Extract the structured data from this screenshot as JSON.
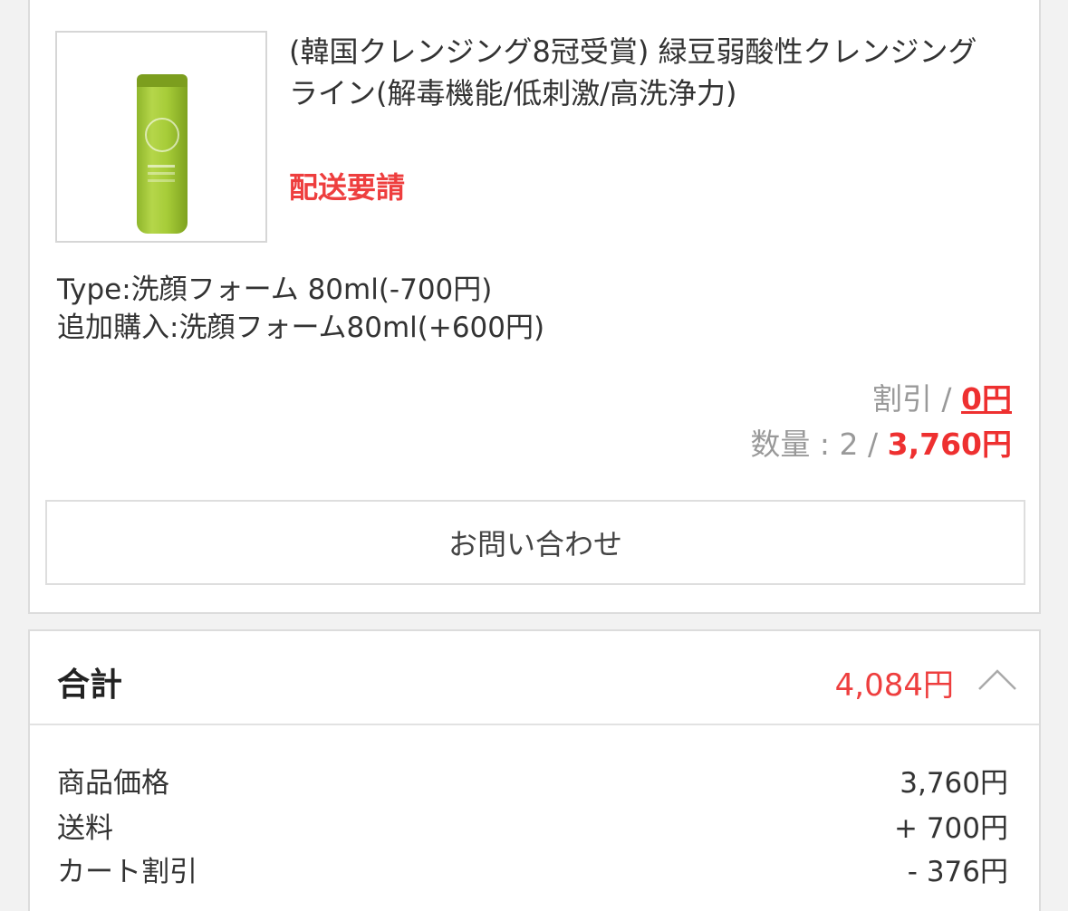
{
  "product": {
    "title": "(韓国クレンジング8冠受賞) 緑豆弱酸性クレンジング ライン(解毒機能/低刺激/高洗浄力)",
    "status": "配送要請",
    "options": [
      "Type:洗顔フォーム 80ml(-700円)",
      "追加購入:洗顔フォーム80ml(+600円)"
    ],
    "discount_label": "割引 / ",
    "discount_value": "0円",
    "quantity_label": "数量 : 2 / ",
    "quantity_total": "3,760円",
    "inquiry_button": "お問い合わせ"
  },
  "summary": {
    "title": "合計",
    "total": "4,084円",
    "rows": [
      {
        "label": "商品価格",
        "value": "3,760円"
      },
      {
        "label": "送料",
        "value": "+ 700円"
      },
      {
        "label": "カート割引",
        "value": "- 376円"
      }
    ]
  },
  "colors": {
    "accent_red": "#ee3e3e",
    "product_green": "#a6cc38"
  }
}
